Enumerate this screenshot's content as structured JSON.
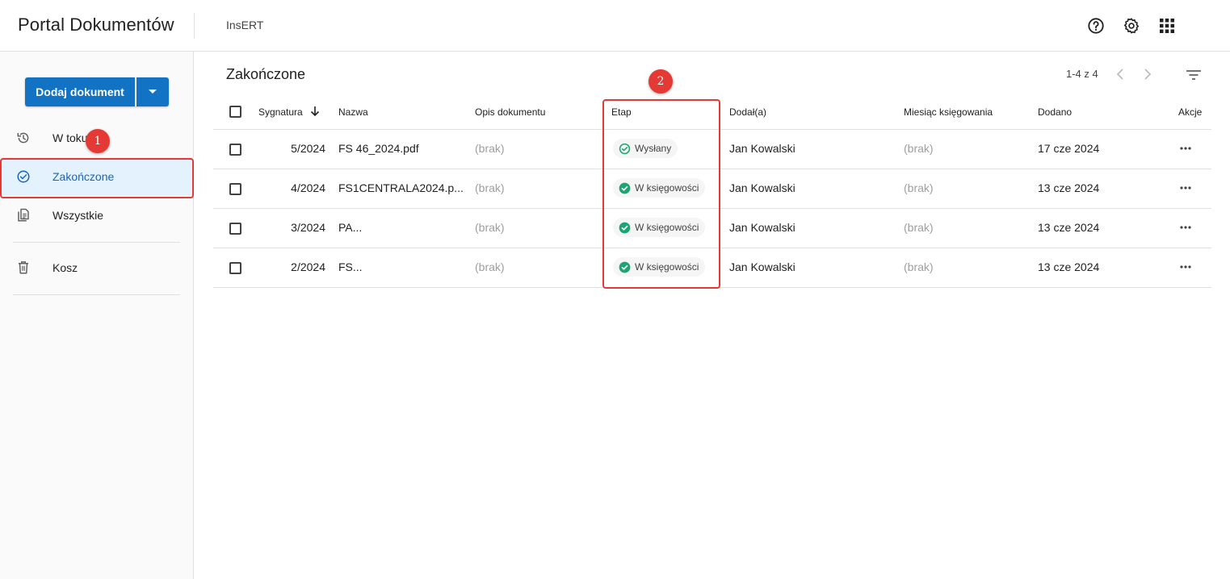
{
  "app": {
    "title": "Portal Dokumentów",
    "company": "InsERT"
  },
  "toolbar": {
    "icons": [
      "help-icon",
      "settings-icon",
      "apps-grid-icon"
    ]
  },
  "sidebar": {
    "add_button": "Dodaj dokument",
    "items": [
      {
        "label": "W toku",
        "icon": "history-icon"
      },
      {
        "label": "Zakończone",
        "icon": "check-circle-icon",
        "active": true
      },
      {
        "label": "Wszystkie",
        "icon": "documents-icon"
      },
      {
        "label": "Kosz",
        "icon": "trash-icon"
      }
    ]
  },
  "main": {
    "title": "Zakończone",
    "pager": "1-4 z 4",
    "columns": {
      "sygnatura": "Sygnatura",
      "nazwa": "Nazwa",
      "opis": "Opis dokumentu",
      "etap": "Etap",
      "dodal": "Dodał(a)",
      "miesiac": "Miesiąc księgowania",
      "dodano": "Dodano",
      "akcje": "Akcje"
    },
    "rows": [
      {
        "sygnatura": "5/2024",
        "nazwa": "FS 46_2024.pdf",
        "opis": "(brak)",
        "etap": "Wysłany",
        "dodal": "Jan Kowalski",
        "miesiac": "(brak)",
        "dodano": "17 cze 2024"
      },
      {
        "sygnatura": "4/2024",
        "nazwa": "FS1CENTRALA2024.p...",
        "opis": "(brak)",
        "etap": "W księgowości",
        "dodal": "Jan Kowalski",
        "miesiac": "(brak)",
        "dodano": "13 cze 2024"
      },
      {
        "sygnatura": "3/2024",
        "nazwa": "PA...",
        "opis": "(brak)",
        "etap": "W księgowości",
        "dodal": "Jan Kowalski",
        "miesiac": "(brak)",
        "dodano": "13 cze 2024"
      },
      {
        "sygnatura": "2/2024",
        "nazwa": "FS...",
        "opis": "(brak)",
        "etap": "W księgowości",
        "dodal": "Jan Kowalski",
        "miesiac": "(brak)",
        "dodano": "13 cze 2024"
      }
    ]
  },
  "annotations": {
    "badge1": "1",
    "badge2": "2"
  },
  "colors": {
    "accent": "#1273c4",
    "annotation": "#e53935",
    "status_green": "#1aa672"
  }
}
